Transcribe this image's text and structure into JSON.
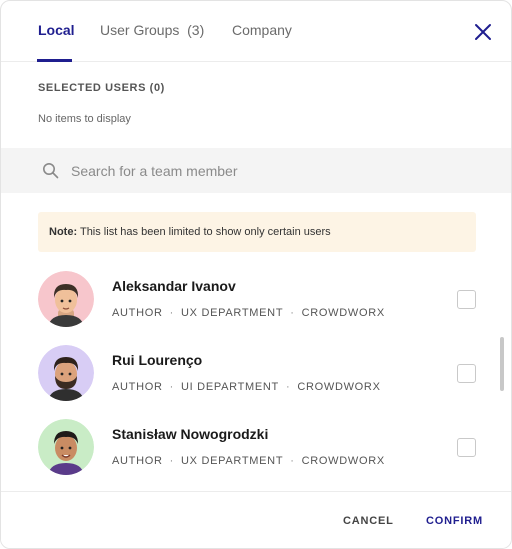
{
  "tabs": {
    "local": "Local",
    "user_groups": "User Groups",
    "user_groups_count": "(3)",
    "company": "Company"
  },
  "selected": {
    "title": "SELECTED USERS (0)",
    "empty": "No items to display"
  },
  "search": {
    "placeholder": "Search for a team member"
  },
  "note": {
    "label": "Note:",
    "text": "This list has been limited to show only certain users"
  },
  "users": [
    {
      "name": "Aleksandar Ivanov",
      "role": "AUTHOR",
      "department": "UX DEPARTMENT",
      "company": "CROWDWORX",
      "avatar_bg": "#f7c6cc"
    },
    {
      "name": "Rui Lourenço",
      "role": "AUTHOR",
      "department": "UI DEPARTMENT",
      "company": "CROWDWORX",
      "avatar_bg": "#d8cdf5"
    },
    {
      "name": "Stanisław Nowogrodzki",
      "role": "AUTHOR",
      "department": "UX DEPARTMENT",
      "company": "CROWDWORX",
      "avatar_bg": "#c9ecc6"
    }
  ],
  "footer": {
    "cancel": "CANCEL",
    "confirm": "CONFIRM"
  },
  "colors": {
    "accent": "#1f1e8f",
    "note_bg": "#fdf4e5",
    "search_bg": "#f4f4f4"
  }
}
